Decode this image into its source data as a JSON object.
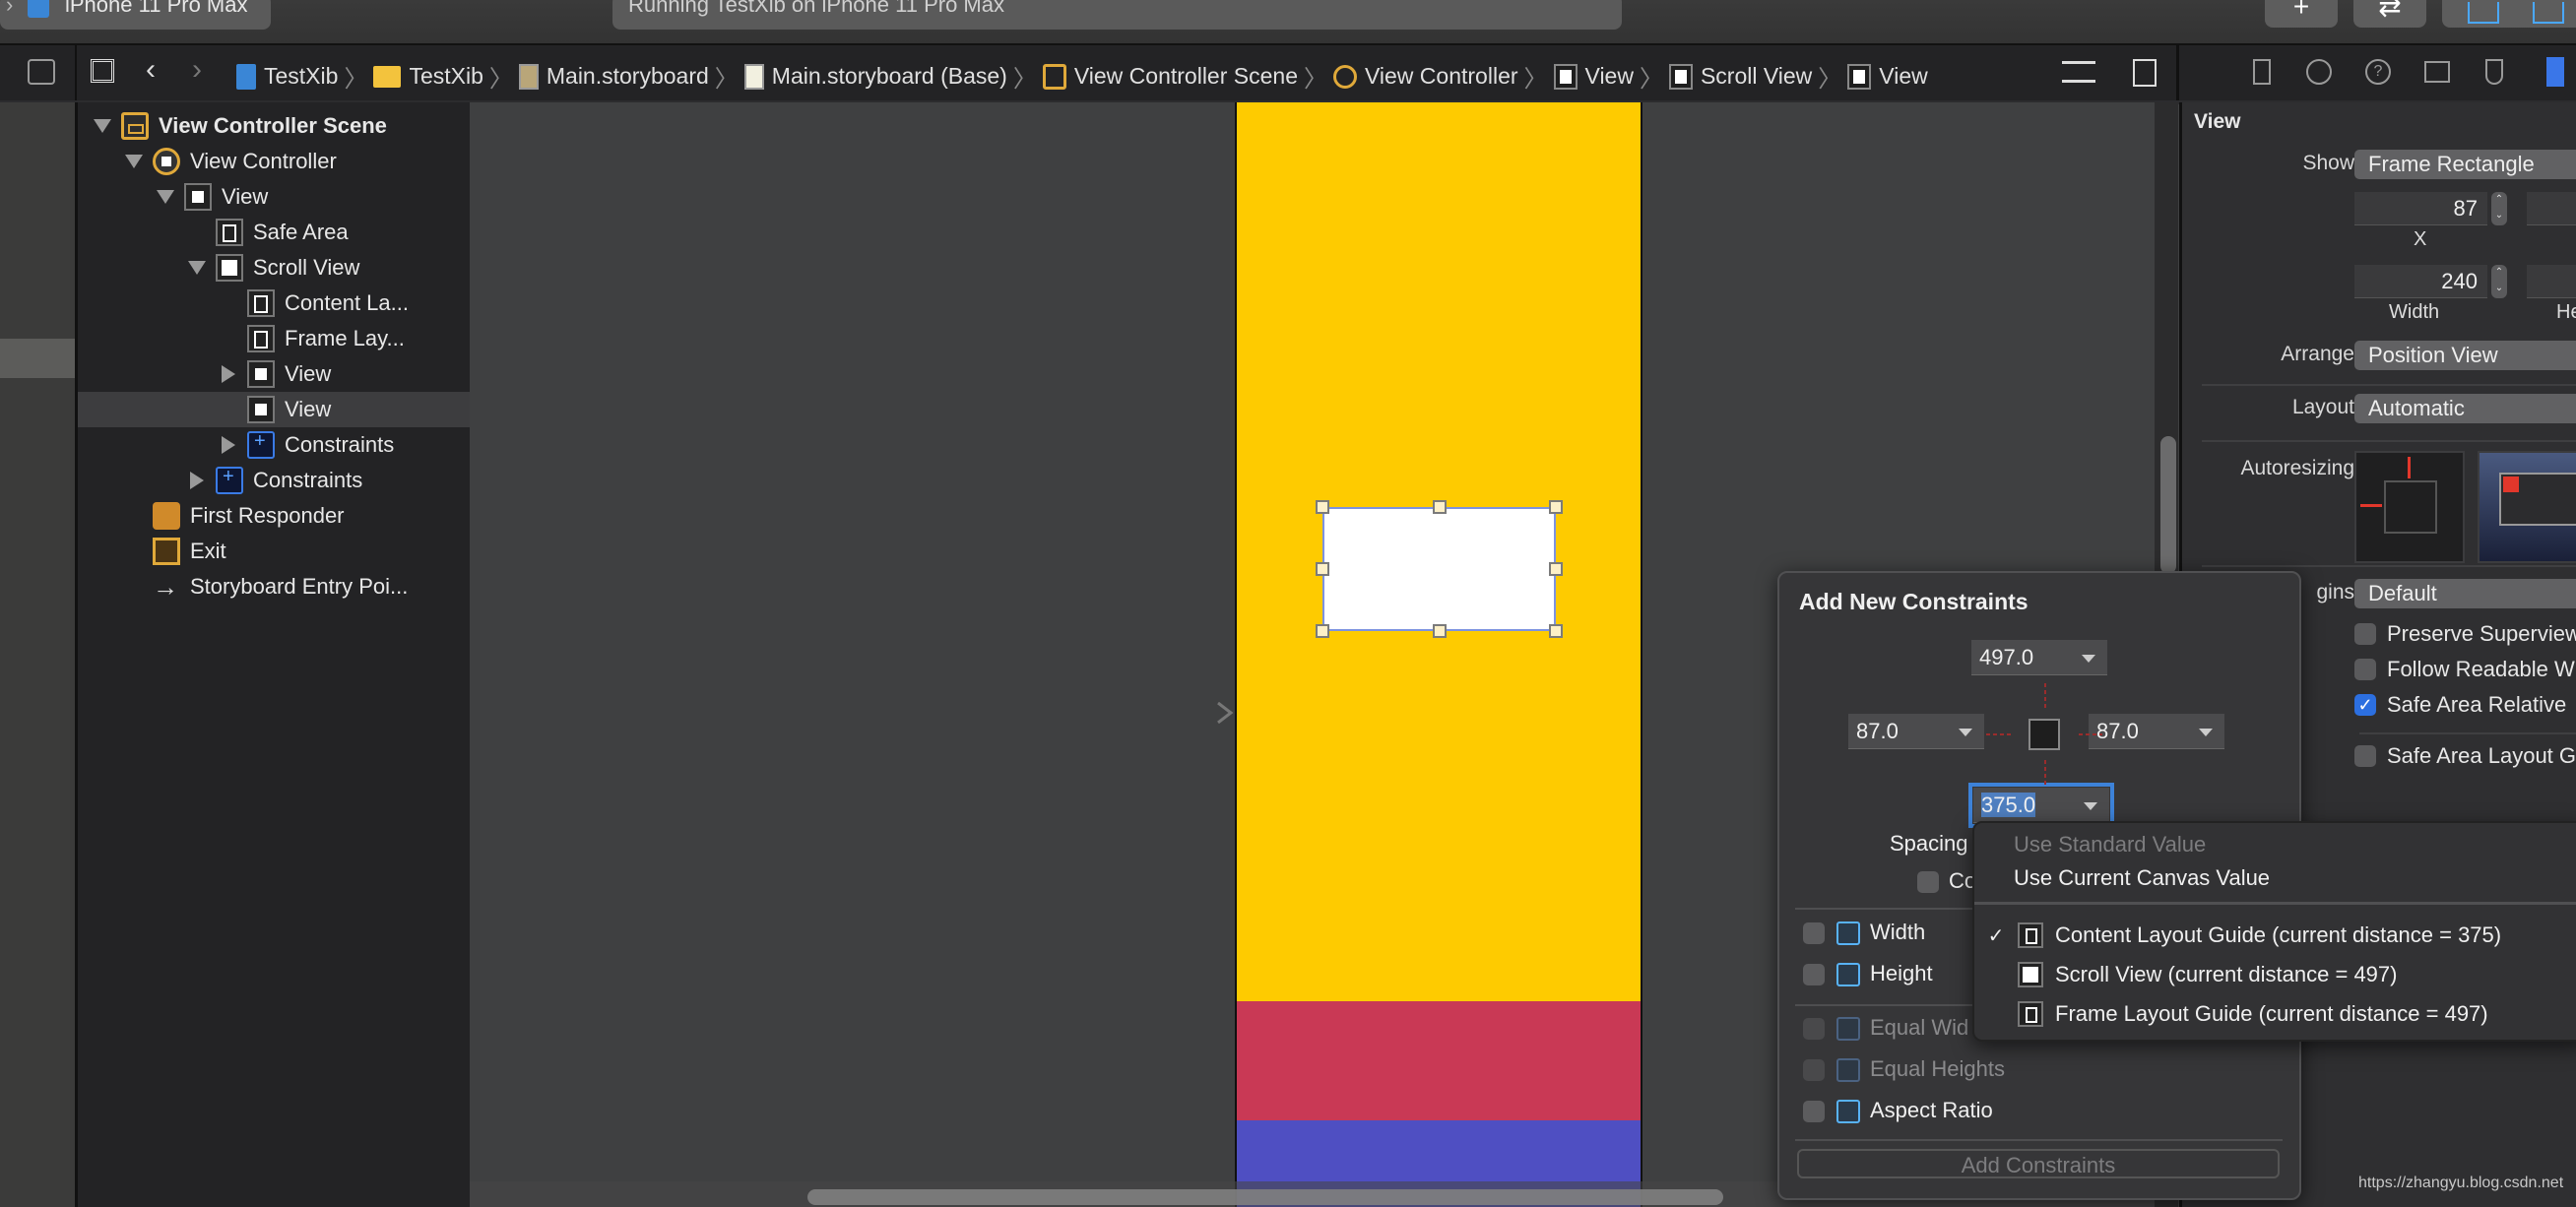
{
  "titlebar": {
    "scheme_device": "iPhone 11 Pro Max",
    "activity": "Running TestXib on iPhone 11 Pro Max",
    "buttons": [
      {
        "name": "library",
        "glyph": "+"
      },
      {
        "name": "code-review",
        "glyph": "⇄"
      }
    ]
  },
  "jumpbar": {
    "crumbs": [
      {
        "label": "TestXib",
        "icon": "project-icon"
      },
      {
        "label": "TestXib",
        "icon": "folder-icon"
      },
      {
        "label": "Main.storyboard",
        "icon": "storyboard-icon"
      },
      {
        "label": "Main.storyboard (Base)",
        "icon": "storyboard-file-icon"
      },
      {
        "label": "View Controller Scene",
        "icon": "scene-icon"
      },
      {
        "label": "View Controller",
        "icon": "view-controller-icon"
      },
      {
        "label": "View",
        "icon": "view-icon"
      },
      {
        "label": "Scroll View",
        "icon": "scroll-view-icon"
      },
      {
        "label": "View",
        "icon": "view-icon"
      }
    ]
  },
  "outline": [
    {
      "label": "View Controller Scene",
      "icon": "scene",
      "disclosure": "down",
      "level": 0,
      "bold": true
    },
    {
      "label": "View Controller",
      "icon": "vc",
      "disclosure": "down",
      "level": 1
    },
    {
      "label": "View",
      "icon": "view",
      "disclosure": "down",
      "level": 2
    },
    {
      "label": "Safe Area",
      "icon": "guide",
      "disclosure": "none",
      "level": 3
    },
    {
      "label": "Scroll View",
      "icon": "scroll",
      "disclosure": "down",
      "level": 3
    },
    {
      "label": "Content La...",
      "icon": "guide",
      "disclosure": "none",
      "level": 4
    },
    {
      "label": "Frame Lay...",
      "icon": "guide",
      "disclosure": "none",
      "level": 4
    },
    {
      "label": "View",
      "icon": "view",
      "disclosure": "right",
      "level": 4
    },
    {
      "label": "View",
      "icon": "view",
      "disclosure": "none",
      "level": 4,
      "selected": true
    },
    {
      "label": "Constraints",
      "icon": "cons",
      "disclosure": "right",
      "level": 4
    },
    {
      "label": "Constraints",
      "icon": "cons",
      "disclosure": "right",
      "level": 3
    },
    {
      "label": "First Responder",
      "icon": "fr",
      "disclosure": "none",
      "level": 1
    },
    {
      "label": "Exit",
      "icon": "exit",
      "disclosure": "none",
      "level": 1
    },
    {
      "label": "Storyboard Entry Poi...",
      "icon": "arrow",
      "disclosure": "none",
      "level": 1
    }
  ],
  "canvas": {
    "colors": {
      "top_view": "#fecb00",
      "middle_view": "#c93955",
      "bottom_view": "#4f4fc2",
      "selected_view": "#ffffff"
    }
  },
  "inspector": {
    "section_title": "View",
    "show_label": "Show",
    "show_value": "Frame Rectangle",
    "x_value": "87",
    "x_label": "X",
    "width_value": "240",
    "width_label": "Width",
    "height_label_partial": "He",
    "arrange_label": "Arrange",
    "arrange_value": "Position View",
    "layout_label": "Layout",
    "layout_value": "Automatic",
    "autoresizing_label": "Autoresizing",
    "margins_label_partial": "gins",
    "margins_value": "Default",
    "checkboxes": [
      {
        "label": "Preserve Superview",
        "checked": false
      },
      {
        "label": "Follow Readable W",
        "checked": false
      },
      {
        "label": "Safe Area Relative",
        "checked": true
      },
      {
        "label": "Safe Area Layout G",
        "checked": false
      }
    ]
  },
  "popover": {
    "title": "Add New Constraints",
    "top_value": "497.0",
    "left_value": "87.0",
    "right_value": "87.0",
    "bottom_value": "375.0",
    "spacing_label_partial": "Spacing",
    "constrain_margins_partial": "Co",
    "options": [
      {
        "label": "Width",
        "enabled": true
      },
      {
        "label": "Height",
        "enabled": true
      },
      {
        "label": "Equal Wid",
        "enabled": false
      },
      {
        "label": "Equal Heights",
        "enabled": false
      },
      {
        "label": "Aspect Ratio",
        "enabled": true
      }
    ],
    "add_button": "Add Constraints"
  },
  "menu": {
    "items": [
      {
        "label": "Use Standard Value",
        "enabled": false
      },
      {
        "label": "Use Current Canvas Value",
        "enabled": true
      }
    ],
    "targets": [
      {
        "label": "Content Layout Guide (current distance = 375)",
        "checked": true,
        "icon": "guide"
      },
      {
        "label": "Scroll View (current distance = 497)",
        "checked": false,
        "icon": "scroll"
      },
      {
        "label": "Frame Layout Guide (current distance = 497)",
        "checked": false,
        "icon": "guide"
      }
    ],
    "check_glyph": "✓"
  },
  "watermark": "https://zhangyu.blog.csdn.net"
}
